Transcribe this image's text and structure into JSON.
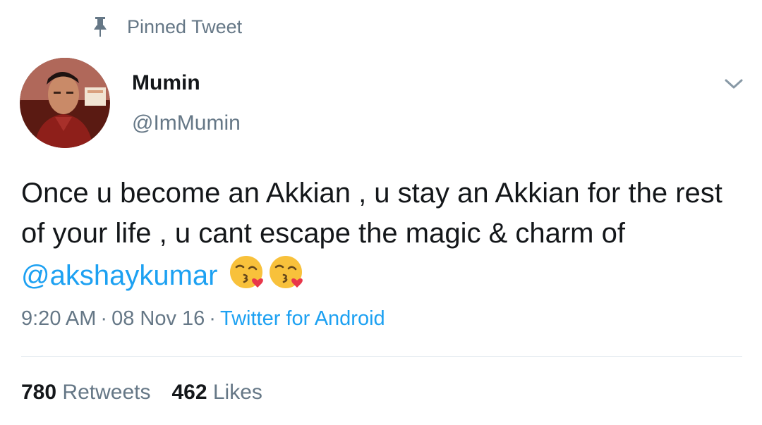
{
  "pinned": {
    "label": "Pinned Tweet",
    "icon": "pin-icon"
  },
  "user": {
    "display_name": "Mumin",
    "handle": "@ImMumin",
    "avatar_icon": "avatar-photo"
  },
  "menu": {
    "icon": "chevron-down-icon"
  },
  "tweet": {
    "text_before_mention": "Once u become an Akkian , u stay an Akkian for the rest of your life , u cant escape the magic & charm of ",
    "mention": "@akshaykumar",
    "emoji_icons": [
      "face-blowing-kiss-emoji",
      "face-blowing-kiss-emoji"
    ]
  },
  "meta": {
    "time": "9:20 AM",
    "separator": "·",
    "date": "08 Nov 16",
    "source": "Twitter for Android"
  },
  "stats": {
    "retweets_count": "780",
    "retweets_label": "Retweets",
    "likes_count": "462",
    "likes_label": "Likes"
  },
  "colors": {
    "link": "#1da1f2",
    "muted": "#657786",
    "text": "#14171a",
    "divider": "#e1e8ed"
  }
}
